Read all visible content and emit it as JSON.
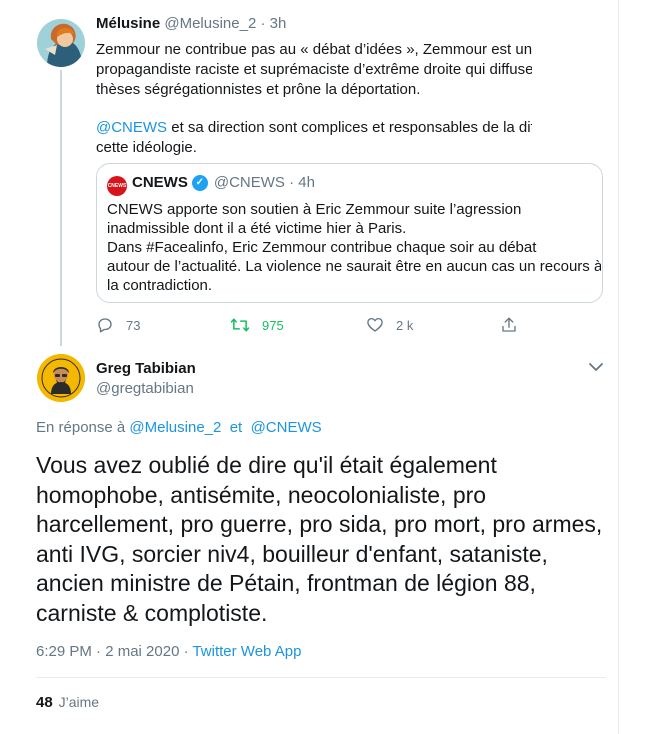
{
  "parent_tweet": {
    "display_name": "Mélusine",
    "handle": "@Melusine_2",
    "time": "· 3h",
    "lines": [
      "Zemmour ne contribue pas au « débat d’idées », Zemmour est un",
      "propagandiste raciste et suprémaciste d’extrême droite qui diffuse",
      "thèses ségrégationnistes et prône la déportation."
    ],
    "mention": "@CNEWS",
    "line4_rest": " et sa direction sont complices et responsables de la diff",
    "line5": "cette idéologie."
  },
  "quote": {
    "avatar_text": "CNEWS",
    "name": "CNEWS",
    "handle_time": "@CNEWS · 4h",
    "lines": [
      "CNEWS apporte son soutien à Eric Zemmour suite l’agression",
      "inadmissible dont il a été victime hier à Paris.",
      "Dans #Facealinfo, Eric Zemmour contribue chaque soir au débat",
      "autour de l’actualité. La violence ne saurait être en aucun cas un recours à",
      "la contradiction."
    ]
  },
  "actions": {
    "replies": "73",
    "retweets": "975",
    "likes": "2 k"
  },
  "reply_tweet": {
    "display_name": "Greg Tabibian",
    "handle": "@gregtabibian",
    "replying_prefix": "En réponse à",
    "replying_to_1": "@Melusine_2",
    "replying_and": "et",
    "replying_to_2": "@CNEWS",
    "lines": [
      "Vous avez oublié de dire qu'il était également",
      "homophobe, antisémite, neocolonialiste, pro",
      "harcellement, pro guerre, pro sida, pro mort, pro armes,",
      "anti IVG, sorcier niv4, bouilleur d'enfant, sataniste,",
      "ancien ministre de Pétain, frontman de légion 88,",
      "carniste & complotiste."
    ],
    "timestamp": "6:29 PM · 2 mai 2020 · ",
    "source": "Twitter Web App",
    "likes_count": "48",
    "likes_label": "J’aime"
  },
  "colors": {
    "accent": "#1b95e0",
    "retweet_active": "#17bf63",
    "muted": "#657786",
    "text": "#14171a",
    "cnews_red": "#d7141c",
    "verified": "#1da1f2"
  },
  "icons": [
    "reply-icon",
    "retweet-icon",
    "like-icon",
    "share-icon",
    "verified-icon",
    "chevron-down-icon"
  ]
}
